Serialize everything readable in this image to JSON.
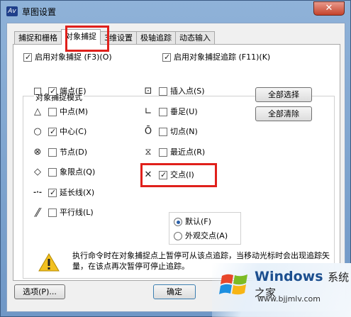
{
  "window": {
    "title": "草图设置",
    "close_glyph": "✕",
    "app_icon_text": "Av"
  },
  "tabs": [
    {
      "label": "捕捉和栅格",
      "active": false
    },
    {
      "label": "对象捕捉",
      "active": true
    },
    {
      "label": "3维设置",
      "active": false
    },
    {
      "label": "极轴追踪",
      "active": false
    },
    {
      "label": "动态输入",
      "active": false
    }
  ],
  "top_options": {
    "enable_osnap": {
      "label": "启用对象捕捉 (F3)(O)",
      "checked": true
    },
    "enable_tracking": {
      "label": "启用对象捕捉追踪 (F11)(K)",
      "checked": true
    }
  },
  "group_title": "对象捕捉模式",
  "snap_left": [
    {
      "symbol": "□",
      "icon": "square-icon",
      "label": "端点(E)",
      "checked": true
    },
    {
      "symbol": "△",
      "icon": "triangle-icon",
      "label": "中点(M)",
      "checked": false
    },
    {
      "symbol": "○",
      "icon": "circle-icon",
      "label": "中心(C)",
      "checked": true
    },
    {
      "symbol": "⊗",
      "icon": "node-icon",
      "label": "节点(D)",
      "checked": false
    },
    {
      "symbol": "◇",
      "icon": "diamond-icon",
      "label": "象限点(Q)",
      "checked": false
    },
    {
      "symbol": "-·-",
      "icon": "extension-icon",
      "label": "延长线(X)",
      "checked": true
    },
    {
      "symbol": "∥",
      "icon": "parallel-icon",
      "label": "平行线(L)",
      "checked": false
    }
  ],
  "snap_right": [
    {
      "symbol": "⊡",
      "icon": "insertion-icon",
      "label": "插入点(S)",
      "checked": false
    },
    {
      "symbol": "∟",
      "icon": "perpendicular-icon",
      "label": "垂足(U)",
      "checked": false
    },
    {
      "symbol": "Ō",
      "icon": "tangent-icon",
      "label": "切点(N)",
      "checked": false
    },
    {
      "symbol": "⧖",
      "icon": "nearest-icon",
      "label": "最近点(R)",
      "checked": false
    },
    {
      "symbol": "✕",
      "icon": "intersection-icon",
      "label": "交点(I)",
      "checked": true
    }
  ],
  "buttons": {
    "select_all": "全部选择",
    "clear_all": "全部清除",
    "options": "选项(P)...",
    "ok": "确定"
  },
  "radios": [
    {
      "label": "默认(F)",
      "selected": true
    },
    {
      "label": "外观交点(A)",
      "selected": false
    }
  ],
  "note": "执行命令时在对象捕捉点上暂停可从该点追踪，当移动光标时会出现追踪矢量，在该点再次暂停可停止追踪。",
  "watermark": {
    "brand": "Windows",
    "suffix": "系统之家",
    "url": "www.bjjmlv.com"
  },
  "colors": {
    "highlight": "#e0201b",
    "accent": "#2a5fa8"
  }
}
